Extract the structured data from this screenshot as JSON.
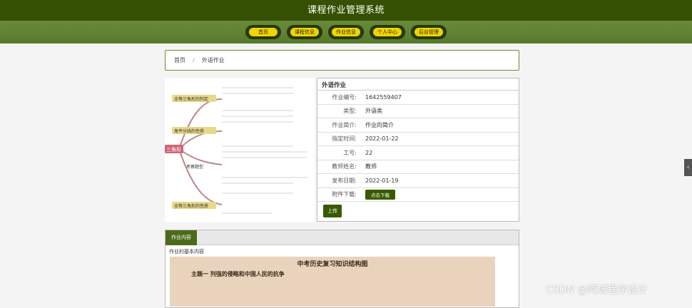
{
  "header": {
    "title": "课程作业管理系统"
  },
  "nav": [
    {
      "label": "首页"
    },
    {
      "label": "课程信息"
    },
    {
      "label": "作业信息"
    },
    {
      "label": "个人中心"
    },
    {
      "label": "后台管理"
    }
  ],
  "breadcrumb": {
    "home": "首页",
    "sep": "/",
    "current": "外语作业"
  },
  "info": {
    "title": "外语作业",
    "rows": [
      {
        "k": "作业编号:",
        "v": "1642559407"
      },
      {
        "k": "类型:",
        "v": "外语类"
      },
      {
        "k": "作业简介:",
        "v": "作业的简介"
      },
      {
        "k": "指定时间:",
        "v": "2022-01-22"
      },
      {
        "k": "工号:",
        "v": "22"
      },
      {
        "k": "教师姓名:",
        "v": "教师"
      },
      {
        "k": "发布日期:",
        "v": "2022-01-19"
      }
    ],
    "attach_label": "附件下载:",
    "download_label": "点击下载",
    "upload_label": "上传"
  },
  "content": {
    "tab": "作业内容",
    "basic": "作业的基本内容",
    "poster_title": "中考历史复习知识结构图",
    "poster_subtitle": "主题一  列强的侵略和中国人民的抗争"
  },
  "mindmap": {
    "center": "三角形",
    "branches": [
      "全等三角形的判定",
      "角平分线的性质",
      "考察题型",
      "全等三角形的性质"
    ]
  },
  "side_toggle": "‹",
  "watermark": "CSDN @阿城程序设计"
}
